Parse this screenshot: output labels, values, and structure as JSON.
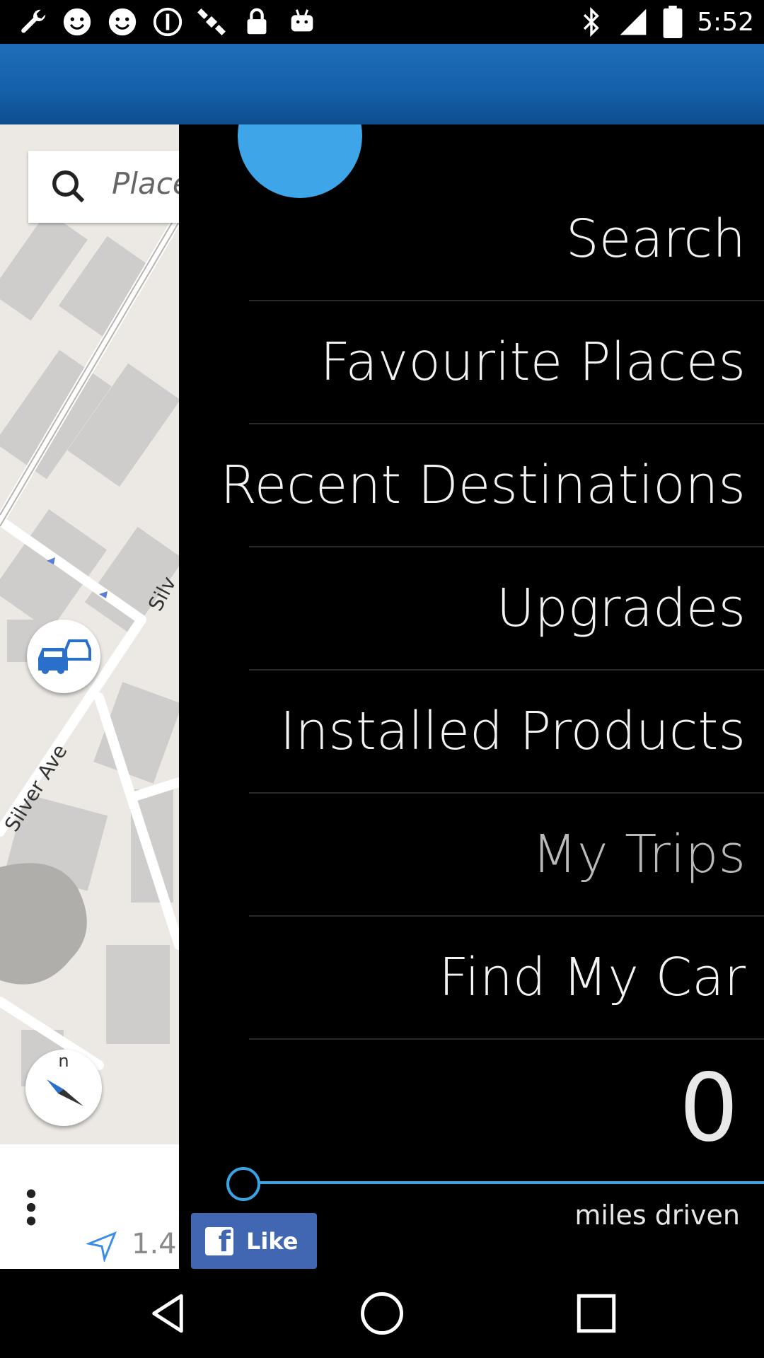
{
  "status_bar": {
    "time": "5:52",
    "icons": [
      "wrench-icon",
      "smiley-icon",
      "smiley-icon",
      "info-circle-icon",
      "satellite-icon",
      "lock-icon",
      "android-icon",
      "bluetooth-icon",
      "signal-icon",
      "battery-icon"
    ]
  },
  "map": {
    "search_placeholder": "Place",
    "street_labels": [
      "Silver Ave",
      "Silv"
    ],
    "compass_label": "n",
    "distance": "1.4"
  },
  "menu": {
    "items": [
      {
        "label": "Search"
      },
      {
        "label": "Favourite Places"
      },
      {
        "label": "Recent Destinations"
      },
      {
        "label": "Upgrades"
      },
      {
        "label": "Installed Products"
      },
      {
        "label": "My Trips"
      },
      {
        "label": "Find My Car"
      }
    ],
    "counter_value": "0",
    "progress_value": 0,
    "counter_label": "miles driven",
    "like_label": "Like"
  },
  "colors": {
    "header_blue": "#1560a8",
    "accent_blue": "#3aa3e0",
    "facebook_blue": "#4267b2"
  }
}
